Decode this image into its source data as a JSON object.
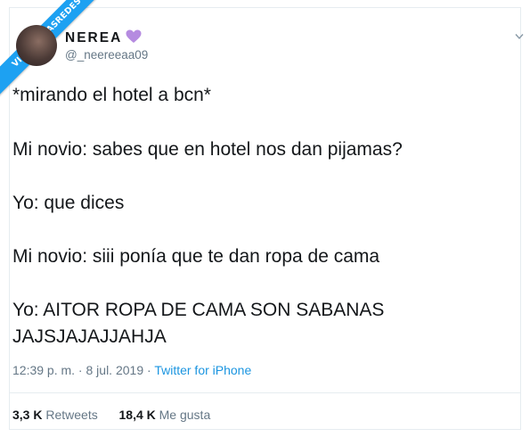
{
  "watermark": {
    "text": "VISTOENLASREDES"
  },
  "user": {
    "name": "NEREA",
    "handle": "@_neereeaa09",
    "badge_icon": "purple-heart-icon",
    "badge_color": "#b58be0"
  },
  "tweet": {
    "lines": [
      "*mirando el hotel a bcn*",
      "Mi novio: sabes que en hotel nos dan pijamas?",
      "Yo: que dices",
      "Mi novio: siii ponía que te dan ropa de cama",
      "Yo: AITOR ROPA DE CAMA SON SABANAS",
      "JAJSJAJAJJAHJA"
    ]
  },
  "meta": {
    "time": "12:39 p. m.",
    "separator": " · ",
    "date": "8 jul. 2019",
    "source": "Twitter for iPhone"
  },
  "stats": {
    "retweets_count": "3,3 K",
    "retweets_label": "Retweets",
    "likes_count": "18,4 K",
    "likes_label": "Me gusta"
  },
  "colors": {
    "accent": "#1da1f2",
    "link": "#1b95e0",
    "secondary_text": "#657786",
    "border": "#e6ecf0"
  }
}
